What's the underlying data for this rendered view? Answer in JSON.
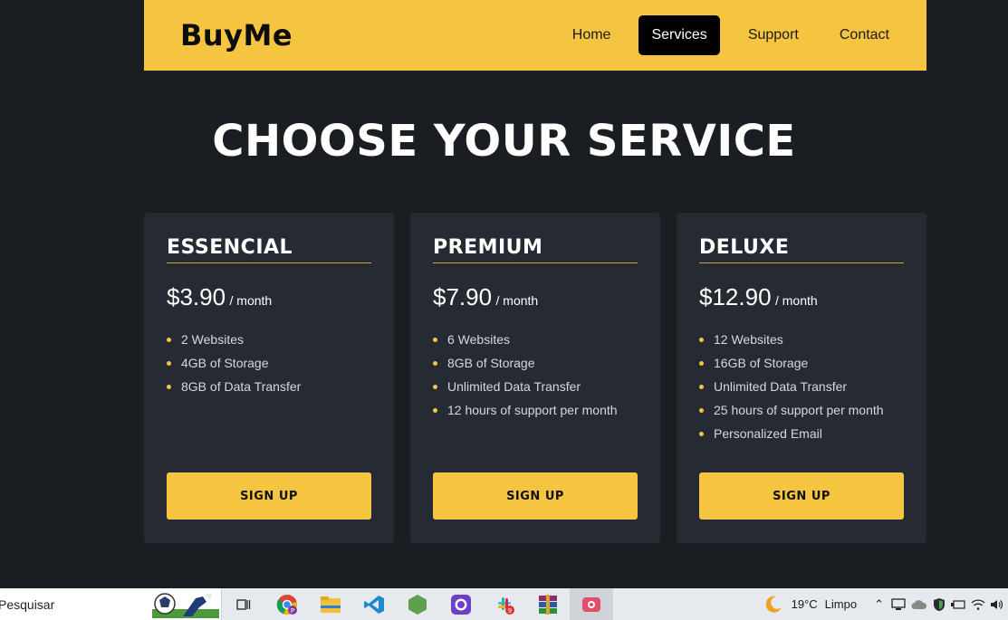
{
  "brand": {
    "logo": "BuyMe",
    "accent_color": "#f5c542"
  },
  "nav": {
    "items": [
      {
        "label": "Home",
        "active": false
      },
      {
        "label": "Services",
        "active": true
      },
      {
        "label": "Support",
        "active": false
      },
      {
        "label": "Contact",
        "active": false
      }
    ]
  },
  "page": {
    "heading": "CHOOSE YOUR SERVICE"
  },
  "plans": [
    {
      "title": "ESSENCIAL",
      "price": "$3.90",
      "period": "/ month",
      "features": [
        "2 Websites",
        "4GB of Storage",
        "8GB of Data Transfer"
      ],
      "button": "SIGN UP"
    },
    {
      "title": "PREMIUM",
      "price": "$7.90",
      "period": "/ month",
      "features": [
        "6 Websites",
        "8GB of Storage",
        "Unlimited Data Transfer",
        "12 hours of support per month"
      ],
      "button": "SIGN UP"
    },
    {
      "title": "DELUXE",
      "price": "$12.90",
      "period": "/ month",
      "features": [
        "12 Websites",
        "16GB of Storage",
        "Unlimited Data Transfer",
        "25 hours of support per month",
        "Personalized Email"
      ],
      "button": "SIGN UP"
    }
  ],
  "taskbar": {
    "search_label": "Pesquisar",
    "apps": [
      "task-view-icon",
      "chrome-icon",
      "file-explorer-icon",
      "vscode-icon",
      "nodejs-icon",
      "github-icon",
      "slack-icon",
      "winrar-icon",
      "screen-recorder-icon"
    ],
    "weather_temp": "19°C",
    "weather_text": "Limpo"
  }
}
